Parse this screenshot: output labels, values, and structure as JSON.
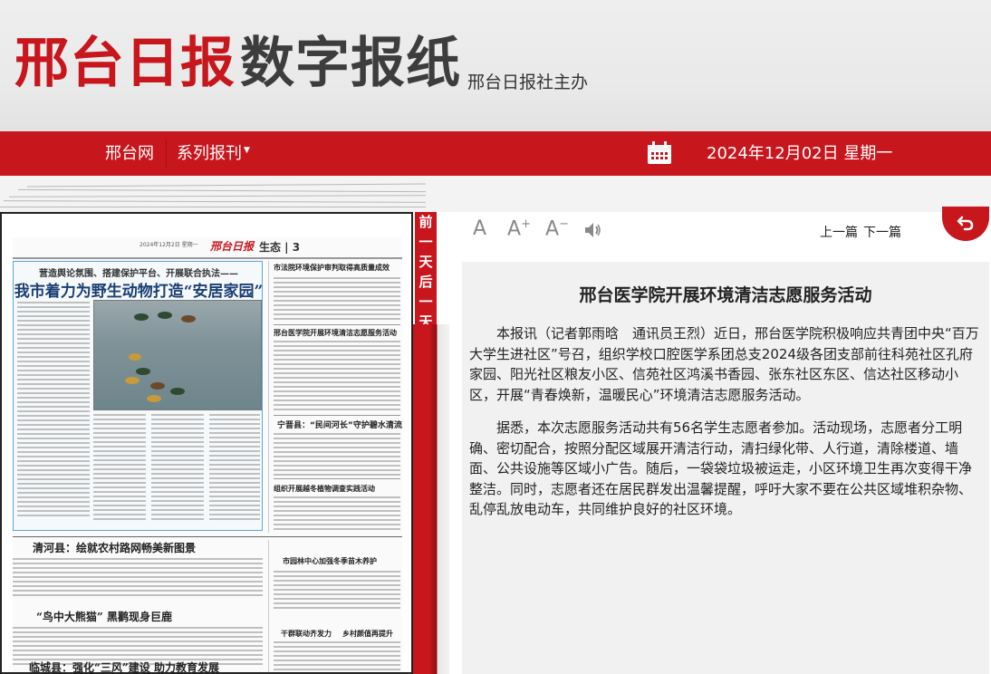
{
  "masthead": {
    "title_red": "邢台日报",
    "title_dark": "数字报纸",
    "subtitle": "邢台日报社主办"
  },
  "nav": {
    "home": "邢台网",
    "series": "系列报刊",
    "date": "2024年12月02日 星期一",
    "calendar_icon": "calendar-icon"
  },
  "paper": {
    "date_line": "2024年12月2日 星期一",
    "logo": "邢台日报",
    "section": "生态 | 3",
    "lead_kicker": "营造舆论氛围、搭建保护平台、开展联合执法——",
    "lead_title": "我市着力为野生动物打造“安居家园”",
    "right_head1": "市法院环境保护审判取得高质量成效",
    "right_head2": "邢台医学院开展环境清洁志愿服务活动",
    "right_head3": "宁晋县：“民间河长”守护碧水清流",
    "right_head4": "组织开展越冬植物调查实践活动",
    "headline_qinghe": "清河县：绘就农村路网畅美新图景",
    "headline_panda": "“鸟中大熊猫” 黑鹳现身巨鹿",
    "headline_linxi": "临城县：强化“三风”建设  助力教育发展",
    "right_head5": "市园林中心加强冬季苗木养护",
    "right_head6": "干群联动齐发力",
    "right_head7": "乡村颜值再提升"
  },
  "side_tab": {
    "chars": [
      "前",
      "一",
      "天",
      "后",
      "一",
      "天"
    ]
  },
  "toolbar": {
    "font_a": "A",
    "font_larger": "A",
    "font_larger_sup": "+",
    "font_smaller": "A",
    "font_smaller_sup": "−",
    "speaker_icon": "speaker-icon",
    "prev": "上一篇",
    "next": "下一篇",
    "back_icon": "back-arrow-icon"
  },
  "article": {
    "title": "邢台医学院开展环境清洁志愿服务活动",
    "para1": "本报讯（记者郭雨晗　通讯员王烈）近日，邢台医学院积极响应共青团中央“百万大学生进社区”号召，组织学校口腔医学系团总支2024级各团支部前往科苑社区孔府家园、阳光社区粮友小区、信苑社区鸿溪书香园、张东社区东区、信达社区移动小区，开展“青春焕新，温暖民心”环境清洁志愿服务活动。",
    "para2": "据悉，本次志愿服务活动共有56名学生志愿者参加。活动现场，志愿者分工明确、密切配合，按照分配区域展开清洁行动，清扫绿化带、人行道，清除楼道、墙面、公共设施等区域小广告。随后，一袋袋垃圾被运走，小区环境卫生再次变得干净整洁。同时，志愿者还在居民群发出温馨提醒，呼吁大家不要在公共区域堆积杂物、乱停乱放电动车，共同维护良好的社区环境。"
  },
  "colors": {
    "brand_red": "#c8161d",
    "title_blue": "#1a3f73"
  }
}
